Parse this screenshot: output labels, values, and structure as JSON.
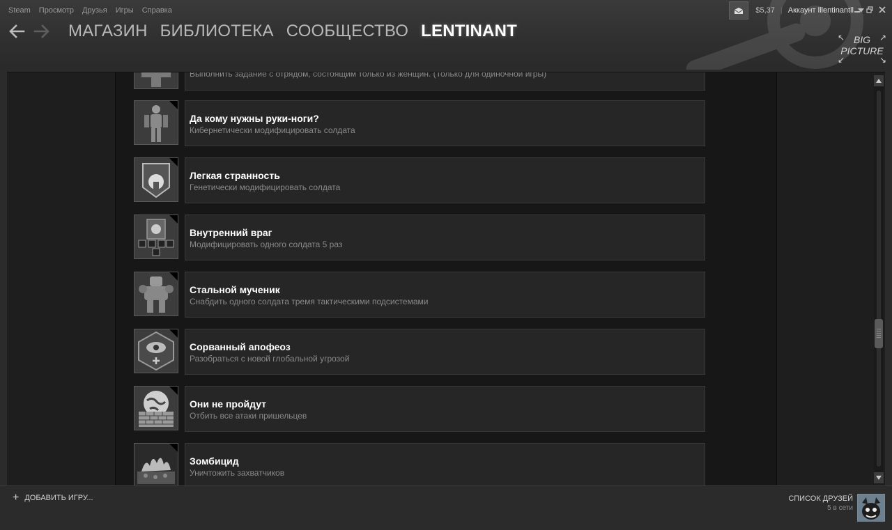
{
  "menu": [
    "Steam",
    "Просмотр",
    "Друзья",
    "Игры",
    "Справка"
  ],
  "nav": {
    "back_icon": "arrow-left-icon",
    "forward_icon": "arrow-right-icon",
    "tabs": [
      {
        "label": "МАГАЗИН",
        "active": false
      },
      {
        "label": "БИБЛИОТЕКА",
        "active": false
      },
      {
        "label": "СООБЩЕСТВО",
        "active": false
      },
      {
        "label": "LENTINANT",
        "active": true
      }
    ]
  },
  "account": {
    "wallet": "$5,37",
    "separator": "|",
    "label": "Аккаунт lllentinantll",
    "notification_icon": "envelope-icon"
  },
  "big_picture": {
    "line1": "BIG",
    "line2": "PICTURE"
  },
  "achievements": [
    {
      "title": "",
      "desc": "Выполнить задание с отрядом, состоящим только из женщин. (Только для одиночной игры)",
      "icon": "medic-cross-icon"
    },
    {
      "title": "Да кому нужны руки-ноги?",
      "desc": "Кибернетически модифицировать солдата",
      "icon": "cyborg-soldier-icon"
    },
    {
      "title": "Легкая странность",
      "desc": "Генетически модифицировать солдата",
      "icon": "gene-mod-emblem-icon"
    },
    {
      "title": "Внутренний враг",
      "desc": "Модифицировать одного солдата 5 раз",
      "icon": "modules-emblem-icon"
    },
    {
      "title": "Стальной мученик",
      "desc": "Снабдить одного солдата тремя тактическими подсистемами",
      "icon": "mec-trooper-icon"
    },
    {
      "title": "Сорванный апофеоз",
      "desc": "Разобраться с новой глобальной угрозой",
      "icon": "eye-sigil-icon"
    },
    {
      "title": "Они не пройдут",
      "desc": "Отбить все атаки пришельцев",
      "icon": "globe-wall-icon"
    },
    {
      "title": "Зомбицид",
      "desc": "Уничтожить захватчиков",
      "icon": "burning-zombies-icon"
    }
  ],
  "bottom": {
    "add_game": "ДОБАВИТЬ ИГРУ...",
    "friends_title": "СПИСОК ДРУЗЕЙ",
    "friends_online": "5 в сети"
  },
  "colors": {
    "accent_text": "#ffffff",
    "muted_text": "#8a8a8a",
    "card_bg": "#262626"
  }
}
